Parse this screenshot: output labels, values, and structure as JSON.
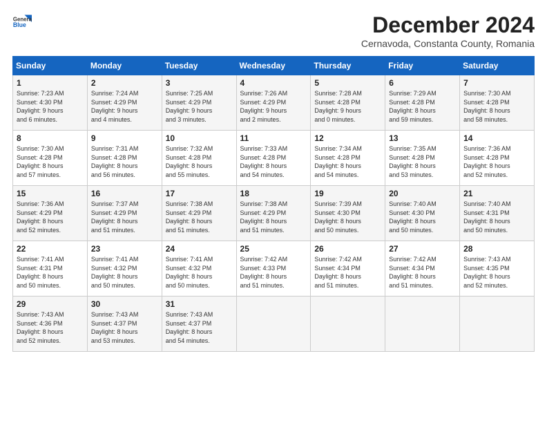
{
  "header": {
    "logo_line1": "General",
    "logo_line2": "Blue",
    "title": "December 2024",
    "location": "Cernavoda, Constanta County, Romania"
  },
  "days_of_week": [
    "Sunday",
    "Monday",
    "Tuesday",
    "Wednesday",
    "Thursday",
    "Friday",
    "Saturday"
  ],
  "weeks": [
    [
      {
        "day": "1",
        "lines": [
          "Sunrise: 7:23 AM",
          "Sunset: 4:30 PM",
          "Daylight: 9 hours",
          "and 6 minutes."
        ]
      },
      {
        "day": "2",
        "lines": [
          "Sunrise: 7:24 AM",
          "Sunset: 4:29 PM",
          "Daylight: 9 hours",
          "and 4 minutes."
        ]
      },
      {
        "day": "3",
        "lines": [
          "Sunrise: 7:25 AM",
          "Sunset: 4:29 PM",
          "Daylight: 9 hours",
          "and 3 minutes."
        ]
      },
      {
        "day": "4",
        "lines": [
          "Sunrise: 7:26 AM",
          "Sunset: 4:29 PM",
          "Daylight: 9 hours",
          "and 2 minutes."
        ]
      },
      {
        "day": "5",
        "lines": [
          "Sunrise: 7:28 AM",
          "Sunset: 4:28 PM",
          "Daylight: 9 hours",
          "and 0 minutes."
        ]
      },
      {
        "day": "6",
        "lines": [
          "Sunrise: 7:29 AM",
          "Sunset: 4:28 PM",
          "Daylight: 8 hours",
          "and 59 minutes."
        ]
      },
      {
        "day": "7",
        "lines": [
          "Sunrise: 7:30 AM",
          "Sunset: 4:28 PM",
          "Daylight: 8 hours",
          "and 58 minutes."
        ]
      }
    ],
    [
      {
        "day": "8",
        "lines": [
          "Sunrise: 7:30 AM",
          "Sunset: 4:28 PM",
          "Daylight: 8 hours",
          "and 57 minutes."
        ]
      },
      {
        "day": "9",
        "lines": [
          "Sunrise: 7:31 AM",
          "Sunset: 4:28 PM",
          "Daylight: 8 hours",
          "and 56 minutes."
        ]
      },
      {
        "day": "10",
        "lines": [
          "Sunrise: 7:32 AM",
          "Sunset: 4:28 PM",
          "Daylight: 8 hours",
          "and 55 minutes."
        ]
      },
      {
        "day": "11",
        "lines": [
          "Sunrise: 7:33 AM",
          "Sunset: 4:28 PM",
          "Daylight: 8 hours",
          "and 54 minutes."
        ]
      },
      {
        "day": "12",
        "lines": [
          "Sunrise: 7:34 AM",
          "Sunset: 4:28 PM",
          "Daylight: 8 hours",
          "and 54 minutes."
        ]
      },
      {
        "day": "13",
        "lines": [
          "Sunrise: 7:35 AM",
          "Sunset: 4:28 PM",
          "Daylight: 8 hours",
          "and 53 minutes."
        ]
      },
      {
        "day": "14",
        "lines": [
          "Sunrise: 7:36 AM",
          "Sunset: 4:28 PM",
          "Daylight: 8 hours",
          "and 52 minutes."
        ]
      }
    ],
    [
      {
        "day": "15",
        "lines": [
          "Sunrise: 7:36 AM",
          "Sunset: 4:29 PM",
          "Daylight: 8 hours",
          "and 52 minutes."
        ]
      },
      {
        "day": "16",
        "lines": [
          "Sunrise: 7:37 AM",
          "Sunset: 4:29 PM",
          "Daylight: 8 hours",
          "and 51 minutes."
        ]
      },
      {
        "day": "17",
        "lines": [
          "Sunrise: 7:38 AM",
          "Sunset: 4:29 PM",
          "Daylight: 8 hours",
          "and 51 minutes."
        ]
      },
      {
        "day": "18",
        "lines": [
          "Sunrise: 7:38 AM",
          "Sunset: 4:29 PM",
          "Daylight: 8 hours",
          "and 51 minutes."
        ]
      },
      {
        "day": "19",
        "lines": [
          "Sunrise: 7:39 AM",
          "Sunset: 4:30 PM",
          "Daylight: 8 hours",
          "and 50 minutes."
        ]
      },
      {
        "day": "20",
        "lines": [
          "Sunrise: 7:40 AM",
          "Sunset: 4:30 PM",
          "Daylight: 8 hours",
          "and 50 minutes."
        ]
      },
      {
        "day": "21",
        "lines": [
          "Sunrise: 7:40 AM",
          "Sunset: 4:31 PM",
          "Daylight: 8 hours",
          "and 50 minutes."
        ]
      }
    ],
    [
      {
        "day": "22",
        "lines": [
          "Sunrise: 7:41 AM",
          "Sunset: 4:31 PM",
          "Daylight: 8 hours",
          "and 50 minutes."
        ]
      },
      {
        "day": "23",
        "lines": [
          "Sunrise: 7:41 AM",
          "Sunset: 4:32 PM",
          "Daylight: 8 hours",
          "and 50 minutes."
        ]
      },
      {
        "day": "24",
        "lines": [
          "Sunrise: 7:41 AM",
          "Sunset: 4:32 PM",
          "Daylight: 8 hours",
          "and 50 minutes."
        ]
      },
      {
        "day": "25",
        "lines": [
          "Sunrise: 7:42 AM",
          "Sunset: 4:33 PM",
          "Daylight: 8 hours",
          "and 51 minutes."
        ]
      },
      {
        "day": "26",
        "lines": [
          "Sunrise: 7:42 AM",
          "Sunset: 4:34 PM",
          "Daylight: 8 hours",
          "and 51 minutes."
        ]
      },
      {
        "day": "27",
        "lines": [
          "Sunrise: 7:42 AM",
          "Sunset: 4:34 PM",
          "Daylight: 8 hours",
          "and 51 minutes."
        ]
      },
      {
        "day": "28",
        "lines": [
          "Sunrise: 7:43 AM",
          "Sunset: 4:35 PM",
          "Daylight: 8 hours",
          "and 52 minutes."
        ]
      }
    ],
    [
      {
        "day": "29",
        "lines": [
          "Sunrise: 7:43 AM",
          "Sunset: 4:36 PM",
          "Daylight: 8 hours",
          "and 52 minutes."
        ]
      },
      {
        "day": "30",
        "lines": [
          "Sunrise: 7:43 AM",
          "Sunset: 4:37 PM",
          "Daylight: 8 hours",
          "and 53 minutes."
        ]
      },
      {
        "day": "31",
        "lines": [
          "Sunrise: 7:43 AM",
          "Sunset: 4:37 PM",
          "Daylight: 8 hours",
          "and 54 minutes."
        ]
      },
      null,
      null,
      null,
      null
    ]
  ]
}
